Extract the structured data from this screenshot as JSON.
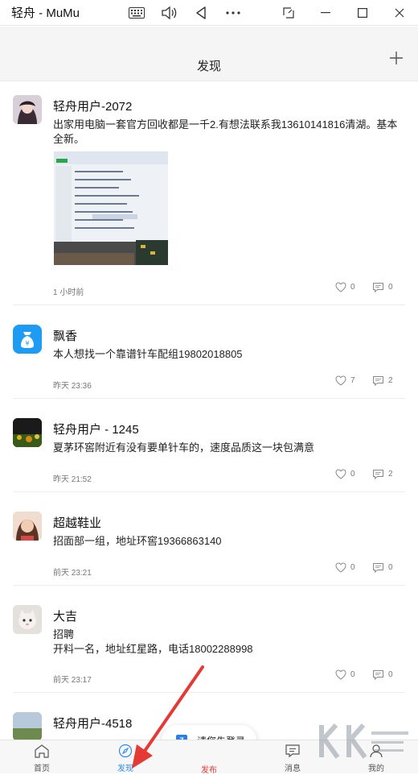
{
  "window": {
    "title": "轻舟 - MuMu"
  },
  "header": {
    "title": "发现"
  },
  "posts": [
    {
      "user": "轻舟用户-2072",
      "text": "出家用电脑一套官方回收都是一千2.有想法联系我13610141816清湖。基本全新。",
      "time": "1 小时前",
      "likes": "0",
      "comments": "0"
    },
    {
      "user": "飘香",
      "text": "本人想找一个靠谱针车配组19802018805",
      "time": "昨天 23:36",
      "likes": "7",
      "comments": "2"
    },
    {
      "user": "轻舟用户 - 1245",
      "text": "夏茅环窖附近有没有要单针车的，速度品质这一块包满意",
      "time": "昨天 21:52",
      "likes": "0",
      "comments": "2"
    },
    {
      "user": "超越鞋业",
      "text": "招面部一组，地址环窖19366863140",
      "time": "前天 23:21",
      "likes": "0",
      "comments": "0"
    },
    {
      "user": "大吉",
      "text_line1": "招聘",
      "text_line2": "开料一名，地址红星路，电话18002288998",
      "time": "前天 23:17",
      "likes": "0",
      "comments": "0"
    },
    {
      "user": "轻舟用户-4518"
    }
  ],
  "toast": {
    "text": "请您先登录"
  },
  "tabs": [
    {
      "label": "首页",
      "icon": "home-icon"
    },
    {
      "label": "发现",
      "icon": "compass-icon",
      "active": true
    },
    {
      "label": "发布",
      "icon": "publish-icon"
    },
    {
      "label": "消息",
      "icon": "message-icon"
    },
    {
      "label": "我的",
      "icon": "user-icon"
    }
  ],
  "colors": {
    "accent": "#2f8bf0",
    "publish": "#e53935",
    "arrow": "#e53935",
    "header_bg": "#f5f5f5"
  }
}
